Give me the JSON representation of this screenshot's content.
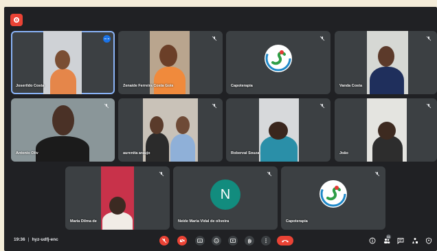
{
  "participants": [
    {
      "name": "Joserildo Costa"
    },
    {
      "name": "Zenaide Ferreira Costa Gois"
    },
    {
      "name": "Capoterapia"
    },
    {
      "name": "Vanda Costa"
    },
    {
      "name": "Antonio Oliv"
    },
    {
      "name": "aurenita araujo"
    },
    {
      "name": "Roberval Souza"
    },
    {
      "name": "João"
    },
    {
      "name": "Maria Dilma de"
    },
    {
      "name": "Neide Maria Vidal de oliveira"
    },
    {
      "name": "Capoterapia"
    }
  ],
  "avatar_letter": "N",
  "meeting": {
    "time": "19:36",
    "separator": "|",
    "code": "hyz-udfj-enc"
  },
  "people_count": "11",
  "colors": {
    "background": "#202124",
    "tile": "#3c4043",
    "accent": "#1a73e8",
    "danger": "#ea4335",
    "avatar": "#128c7e"
  },
  "controls": [
    "mic-off-icon",
    "camera-off-icon",
    "captions-icon",
    "emoji-icon",
    "present-icon",
    "raise-hand-icon",
    "more-options-icon",
    "leave-call-icon"
  ],
  "side_controls": [
    "info-icon",
    "people-icon",
    "chat-icon",
    "activities-icon",
    "host-controls-icon"
  ]
}
